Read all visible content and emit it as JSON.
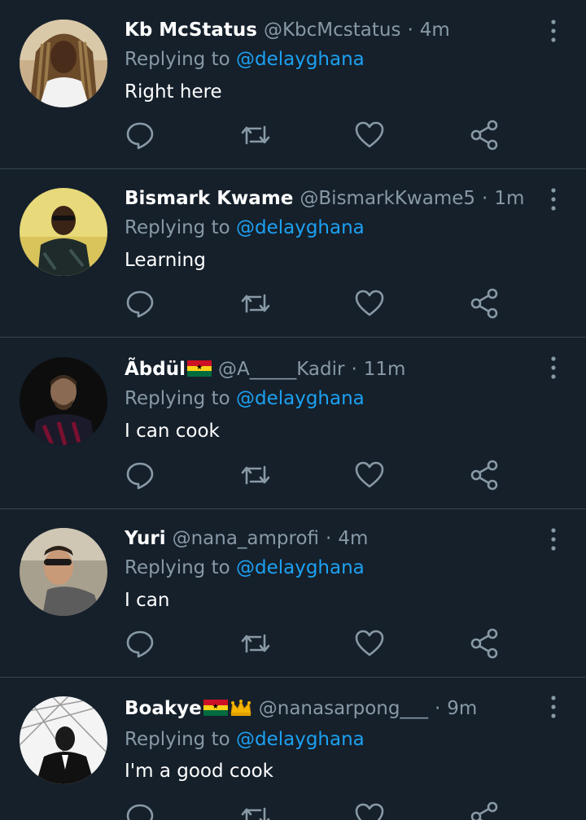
{
  "replying_prefix": "Replying to",
  "reply_target": "@delayghana",
  "colors": {
    "background": "#15202b",
    "divider": "#38444d",
    "muted": "#8899a6",
    "link": "#1da1f2",
    "text": "#ffffff"
  },
  "icons": {
    "reply": "comment-bubble-icon",
    "retweet": "retweet-icon",
    "like": "heart-icon",
    "share": "share-icon",
    "more": "vertical-dots-icon"
  },
  "tweets": [
    {
      "name": "Kb McStatus",
      "handle": "@KbcMcstatus",
      "time": "4m",
      "text": "Right here"
    },
    {
      "name": "Bismark Kwame",
      "handle": "@BismarkKwame5",
      "time": "1m",
      "text": "Learning"
    },
    {
      "name": "Ãbdül",
      "handle": "@A_____Kadir",
      "time": "11m",
      "text": "I can cook",
      "name_emoji": "ghana-flag"
    },
    {
      "name": "Yuri",
      "handle": "@nana_amprofi",
      "time": "4m",
      "text": "I can"
    },
    {
      "name": "Boakye",
      "handle": "@nanasarpong___",
      "time": "9m",
      "text": "I'm a good cook",
      "name_emoji": "ghana-flag, crown"
    }
  ]
}
